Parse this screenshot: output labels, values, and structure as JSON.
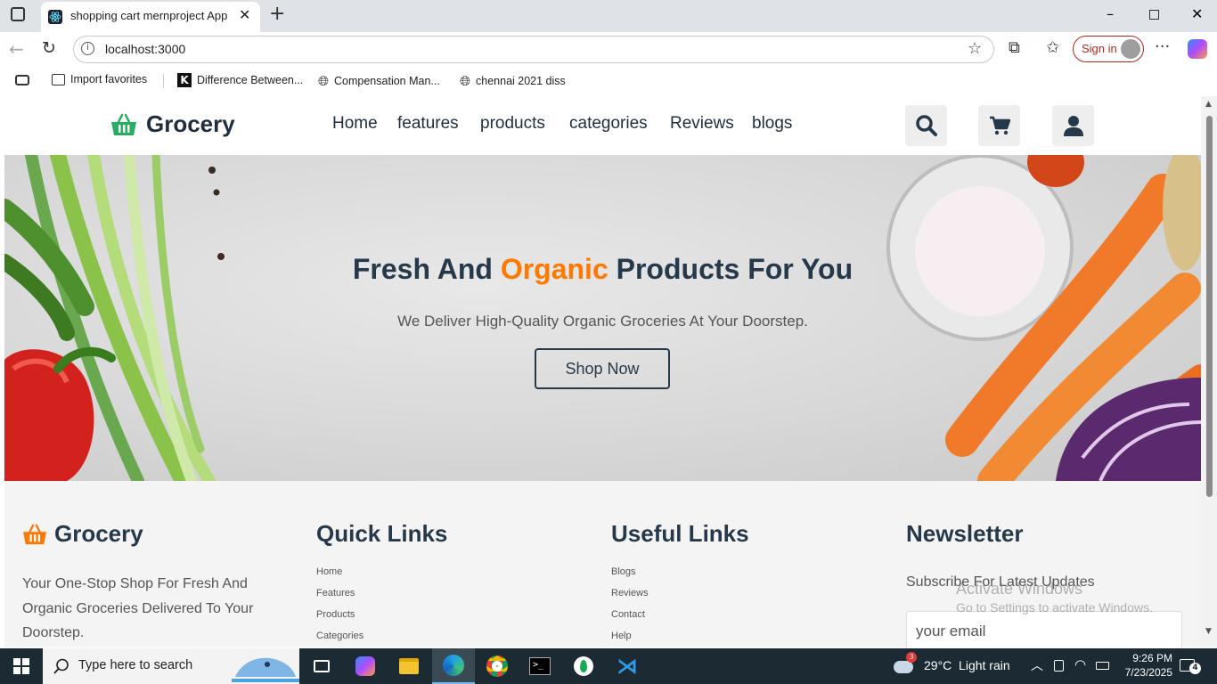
{
  "browser": {
    "tab_title": "shopping cart mernproject App",
    "url": "localhost:3000",
    "signin_label": "Sign in",
    "favorites": [
      "Import favorites",
      "Difference Between...",
      "Compensation Man...",
      "chennai 2021 diss"
    ]
  },
  "site": {
    "brand": "Grocery",
    "nav": [
      "Home",
      "features",
      "products",
      "categories",
      "Reviews",
      "blogs"
    ],
    "hero": {
      "title_part1": "Fresh And ",
      "title_highlight": "Organic",
      "title_part2": " Products For You",
      "subtitle": "We Deliver High-Quality Organic Groceries At Your Doorstep.",
      "cta": "Shop Now"
    },
    "footer": {
      "brand": "Grocery",
      "about": "Your One-Stop Shop For Fresh And Organic Groceries Delivered To Your Doorstep.",
      "quick_links_title": "Quick Links",
      "quick_links": [
        "Home",
        "Features",
        "Products",
        "Categories"
      ],
      "useful_links_title": "Useful Links",
      "useful_links": [
        "Blogs",
        "Reviews",
        "Contact",
        "Help"
      ],
      "newsletter_title": "Newsletter",
      "newsletter_text": "Subscribe For Latest Updates",
      "email_placeholder": "your email"
    },
    "colors": {
      "accent": "#ff7800",
      "brand_green": "#27ae60",
      "text_dark": "#26394b"
    }
  },
  "watermark": {
    "line1": "Activate Windows",
    "line2": "Go to Settings to activate Windows."
  },
  "taskbar": {
    "search_placeholder": "Type here to search",
    "weather": "29°C  Light rain",
    "weather_badge": "3",
    "time": "9:26 PM",
    "date": "7/23/2025",
    "notification_count": "4"
  }
}
